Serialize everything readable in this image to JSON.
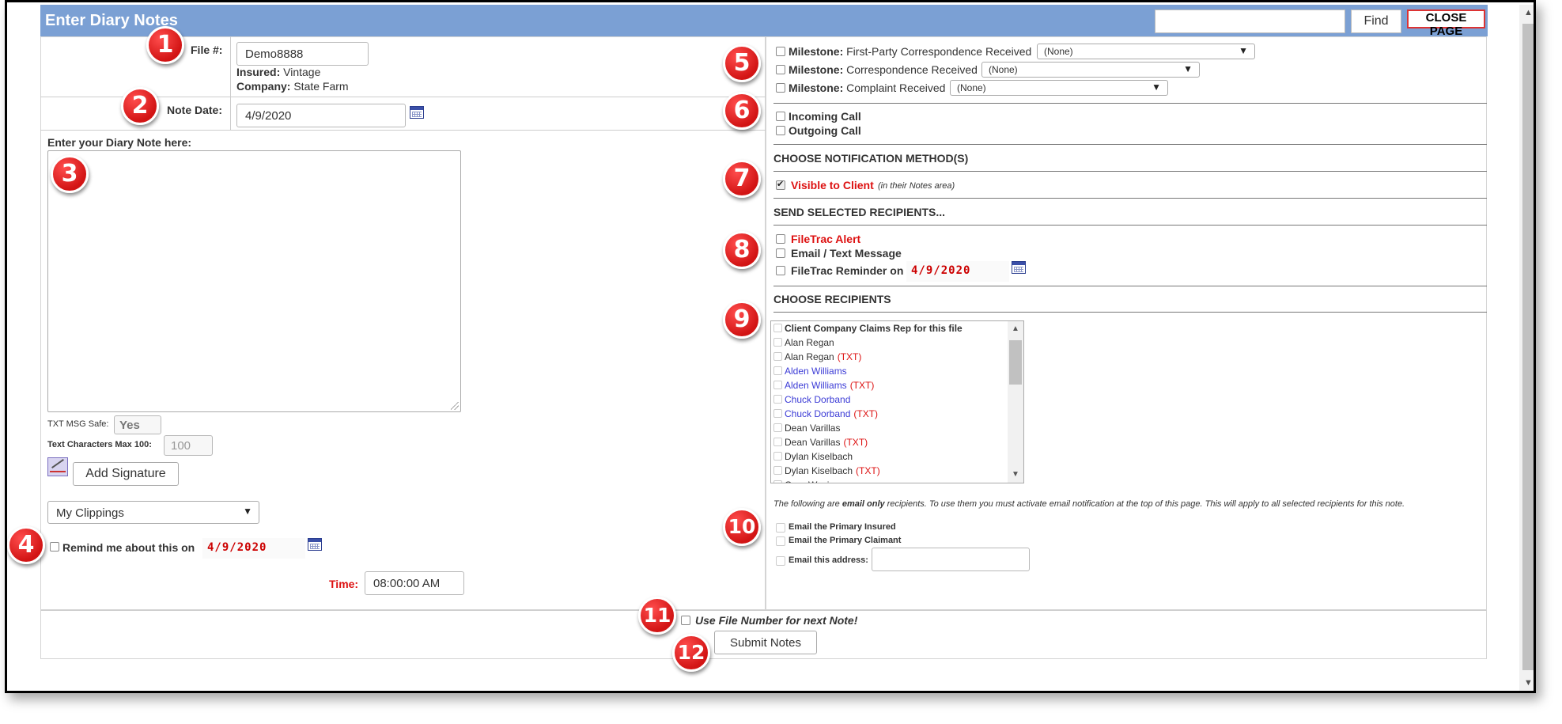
{
  "header": {
    "title": "Enter Diary Notes",
    "find_label": "Find",
    "close_label": "CLOSE PAGE"
  },
  "left": {
    "file_label": "File #:",
    "file_value": "Demo8888",
    "insured_label": "Insured:",
    "insured_value": "Vintage",
    "company_label": "Company:",
    "company_value": "State Farm",
    "note_date_label": "Note Date:",
    "note_date_value": "4/9/2020",
    "note_prompt": "Enter your Diary Note here:",
    "txt_safe_label": "TXT MSG Safe:",
    "txt_safe_value": "Yes",
    "text_max_label": "Text Characters Max 100:",
    "text_max_value": "100",
    "add_signature_label": "Add Signature",
    "clippings_label": "My Clippings",
    "remind_label": "Remind me about this on",
    "remind_date": "4/9/2020",
    "time_label": "Time:",
    "time_value": "08:00:00 AM"
  },
  "right": {
    "milestones": [
      {
        "bold": "Milestone:",
        "text": "First-Party Correspondence Received",
        "select": "(None)"
      },
      {
        "bold": "Milestone:",
        "text": "Correspondence Received",
        "select": "(None)"
      },
      {
        "bold": "Milestone:",
        "text": "Complaint Received",
        "select": "(None)"
      }
    ],
    "incoming_call": "Incoming Call",
    "outgoing_call": "Outgoing Call",
    "notif_head": "CHOOSE NOTIFICATION METHOD(S)",
    "visible_label": "Visible to Client",
    "visible_note": "(in their Notes area)",
    "send_head": "SEND SELECTED RECIPIENTS...",
    "filetrac_alert": "FileTrac Alert",
    "email_text": "Email / Text Message",
    "reminder_label": "FileTrac Reminder on",
    "reminder_date": "4/9/2020",
    "recipients_head": "CHOOSE RECIPIENTS",
    "recipients": [
      {
        "name": "Client Company Claims Rep for this file",
        "txt": "",
        "style": "bold"
      },
      {
        "name": "Alan Regan",
        "txt": "",
        "style": "normal"
      },
      {
        "name": "Alan Regan",
        "txt": "(TXT)",
        "style": "normal"
      },
      {
        "name": "Alden Williams",
        "txt": "",
        "style": "blue"
      },
      {
        "name": "Alden Williams",
        "txt": "(TXT)",
        "style": "blue"
      },
      {
        "name": "Chuck Dorband",
        "txt": "",
        "style": "blue"
      },
      {
        "name": "Chuck Dorband",
        "txt": "(TXT)",
        "style": "blue"
      },
      {
        "name": "Dean Varillas",
        "txt": "",
        "style": "normal"
      },
      {
        "name": "Dean Varillas",
        "txt": "(TXT)",
        "style": "normal"
      },
      {
        "name": "Dylan Kiselbach",
        "txt": "",
        "style": "normal"
      },
      {
        "name": "Dylan Kiselbach",
        "txt": "(TXT)",
        "style": "normal"
      },
      {
        "name": "Greg Wesinger",
        "txt": "",
        "style": "normal"
      }
    ],
    "email_note_pre": "The following are ",
    "email_note_bold": "email only",
    "email_note_post": " recipients. To use them you must activate email notification at the top of this page. This will apply to all selected recipients for this note.",
    "email_insured": "Email the Primary Insured",
    "email_claimant": "Email the Primary Claimant",
    "email_address_label": "Email this address:"
  },
  "footer": {
    "use_file_label": "Use File Number for next Note!",
    "submit_label": "Submit Notes"
  },
  "badges": [
    "1",
    "2",
    "3",
    "4",
    "5",
    "6",
    "7",
    "8",
    "9",
    "10",
    "11",
    "12"
  ],
  "colors": {
    "header_bg": "#7ba0d4",
    "badge_red": "#d21414",
    "alert_red": "#d11",
    "link_blue": "#3b3bd6"
  }
}
